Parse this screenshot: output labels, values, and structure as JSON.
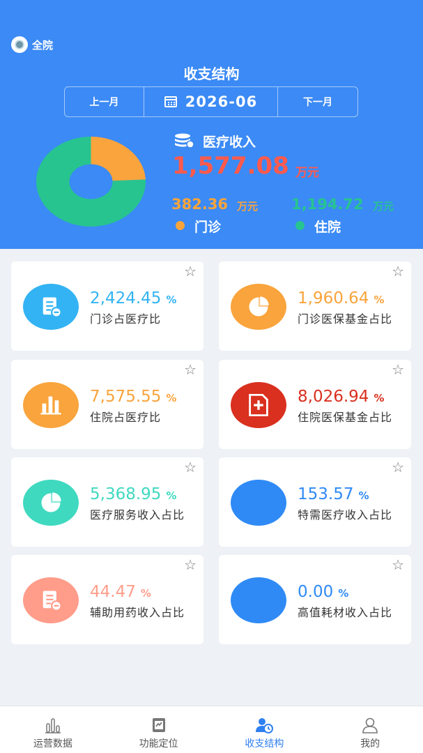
{
  "header": {
    "hospital": "全院",
    "title": "收支结构",
    "prev_month": "上一月",
    "current_month": "2026-06",
    "next_month": "下一月"
  },
  "summary": {
    "income_label": "医疗收入",
    "income_value": "1,577.08",
    "income_unit": "万元",
    "outpatient_value": "382.36",
    "outpatient_unit": "万元",
    "outpatient_label": "门诊",
    "inpatient_value": "1,194.72",
    "inpatient_unit": "万元",
    "inpatient_label": "住院",
    "colors": {
      "outpatient": "#f9a43c",
      "inpatient": "#27c490",
      "income": "#ff5a4d"
    }
  },
  "chart_data": {
    "type": "pie",
    "categories": [
      "门诊",
      "住院"
    ],
    "values": [
      382.36,
      1194.72
    ]
  },
  "cards": [
    {
      "value": "2,424.45",
      "unit": "%",
      "label": "门诊占医疗比",
      "color": "#33b3f3",
      "value_color": "#33b3f3",
      "icon": "document-icon"
    },
    {
      "value": "1,960.64",
      "unit": "%",
      "label": "门诊医保基金占比",
      "color": "#f9a43c",
      "value_color": "#f9a43c",
      "icon": "pie-chart-icon"
    },
    {
      "value": "7,575.55",
      "unit": "%",
      "label": "住院占医疗比",
      "color": "#f9a43c",
      "value_color": "#f9a43c",
      "icon": "bar-chart-icon"
    },
    {
      "value": "8,026.94",
      "unit": "%",
      "label": "住院医保基金占比",
      "color": "#d9301f",
      "value_color": "#d9301f",
      "icon": "medical-file-icon"
    },
    {
      "value": "5,368.95",
      "unit": "%",
      "label": "医疗服务收入占比",
      "color": "#3fd9c0",
      "value_color": "#3fd9c0",
      "icon": "pie-chart-icon"
    },
    {
      "value": "153.57",
      "unit": "%",
      "label": "特需医疗收入占比",
      "color": "#2f8af5",
      "value_color": "#2f8af5",
      "icon": "blank-icon"
    },
    {
      "value": "44.47",
      "unit": "%",
      "label": "辅助用药收入占比",
      "color": "#ff9d8a",
      "value_color": "#ff9d8a",
      "icon": "document-icon"
    },
    {
      "value": "0.00",
      "unit": "%",
      "label": "高值耗材收入占比",
      "color": "#2f8af5",
      "value_color": "#2f8af5",
      "icon": "blank-icon"
    }
  ],
  "tabs": [
    {
      "label": "运营数据",
      "icon": "bar-chart-icon"
    },
    {
      "label": "功能定位",
      "icon": "clipboard-icon"
    },
    {
      "label": "收支结构",
      "icon": "user-clock-icon",
      "active": true
    },
    {
      "label": "我的",
      "icon": "person-icon"
    }
  ]
}
